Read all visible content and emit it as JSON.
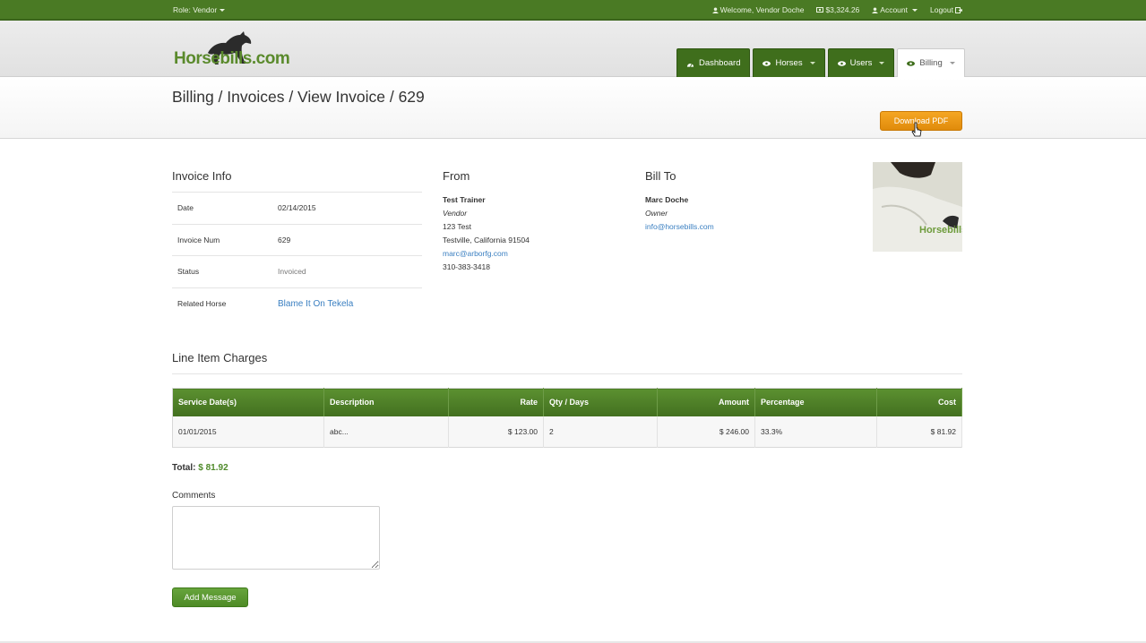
{
  "topbar": {
    "role": "Role: Vendor",
    "welcome": "Welcome, Vendor Doche",
    "balance": "$3,324.26",
    "account": "Account",
    "logout": "Logout"
  },
  "brand": {
    "logo_text": "Horsebills",
    "logo_suffix": ".com"
  },
  "nav": {
    "dashboard": "Dashboard",
    "horses": "Horses",
    "users": "Users",
    "billing": "Billing"
  },
  "page": {
    "title": "Billing / Invoices / View Invoice / 629",
    "download_pdf": "Download PDF"
  },
  "invoice_info": {
    "heading": "Invoice Info",
    "rows": [
      {
        "label": "Date",
        "value": "02/14/2015"
      },
      {
        "label": "Invoice Num",
        "value": "629"
      },
      {
        "label": "Status",
        "value": "Invoiced"
      },
      {
        "label": "Related Horse",
        "value": "Blame It On Tekela"
      }
    ]
  },
  "from": {
    "heading": "From",
    "name": "Test Trainer",
    "role": "Vendor",
    "address1": "123 Test",
    "address2": "Testville, California 91504",
    "email": "marc@arborfg.com",
    "phone": "310-383-3418"
  },
  "bill_to": {
    "heading": "Bill To",
    "name": "Marc Doche",
    "role": "Owner",
    "email": "info@horsebills.com"
  },
  "thumbnail": {
    "logo_text": "Horsebills"
  },
  "line_items": {
    "heading": "Line Item Charges",
    "columns": [
      "Service Date(s)",
      "Description",
      "Rate",
      "Qty / Days",
      "Amount",
      "Percentage",
      "Cost"
    ],
    "rows": [
      [
        "01/01/2015",
        "abc...",
        "$ 123.00",
        "2",
        "$ 246.00",
        "33.3%",
        "$ 81.92"
      ]
    ]
  },
  "total": {
    "label": "Total:",
    "value": "$ 81.92"
  },
  "comments": {
    "label": "Comments",
    "value": "",
    "add_button": "Add Message"
  },
  "colors": {
    "brand_green": "#4a7a24",
    "accent_orange": "#f5a623",
    "link_blue": "#3a7fc1"
  },
  "icons": [
    "user-icon",
    "money-icon",
    "account-user-icon",
    "logout-icon",
    "dashboard-icon",
    "eye-icon",
    "mouse-cursor-icon"
  ]
}
